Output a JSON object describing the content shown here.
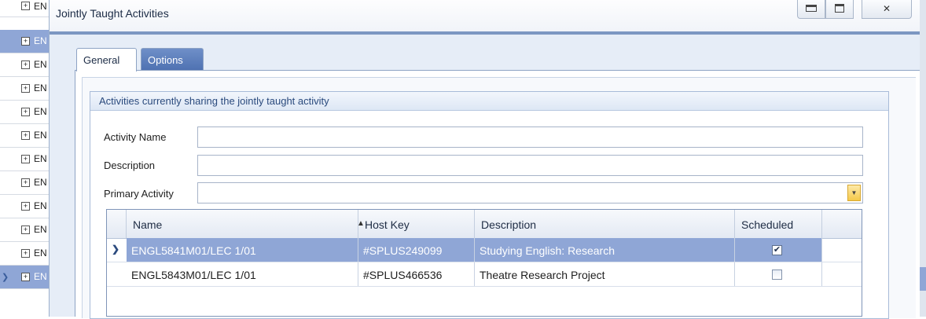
{
  "background_list": {
    "row_text": [
      "EN",
      "EN",
      "EN",
      "EN",
      "EN",
      "EN",
      "EN",
      "EN",
      "EN",
      "EN",
      "EN",
      "EN"
    ],
    "selected_index": 1,
    "current_index": 11
  },
  "window": {
    "title": "Jointly Taught Activities",
    "close_glyph": "✕"
  },
  "tabs": [
    {
      "label": "General",
      "active": true
    },
    {
      "label": "Options",
      "active": false
    }
  ],
  "group": {
    "title": "Activities currently sharing the jointly taught activity"
  },
  "form": {
    "activity_name_label": "Activity Name",
    "activity_name_value": "",
    "description_label": "Description",
    "description_value": "",
    "primary_activity_label": "Primary Activity",
    "primary_activity_value": ""
  },
  "grid": {
    "columns": [
      "Name",
      "Host Key",
      "Description",
      "Scheduled"
    ],
    "sort_column": "Name",
    "sort_direction": "ascending",
    "rows": [
      {
        "name": "ENGL5841M01/LEC 1/01",
        "host_key": "#SPLUS249099",
        "description": "Studying English: Research",
        "scheduled": true,
        "selected": true
      },
      {
        "name": "ENGL5843M01/LEC 1/01",
        "host_key": "#SPLUS466536",
        "description": "Theatre Research Project",
        "scheduled": false,
        "selected": false
      }
    ]
  },
  "colors": {
    "selection": "#8fa6d6",
    "tab_active_bg": "#ffffff",
    "tab_inactive_bg": "#4f72b2",
    "group_header_text": "#2a4a7d",
    "combo_button": "#f5c94a"
  }
}
